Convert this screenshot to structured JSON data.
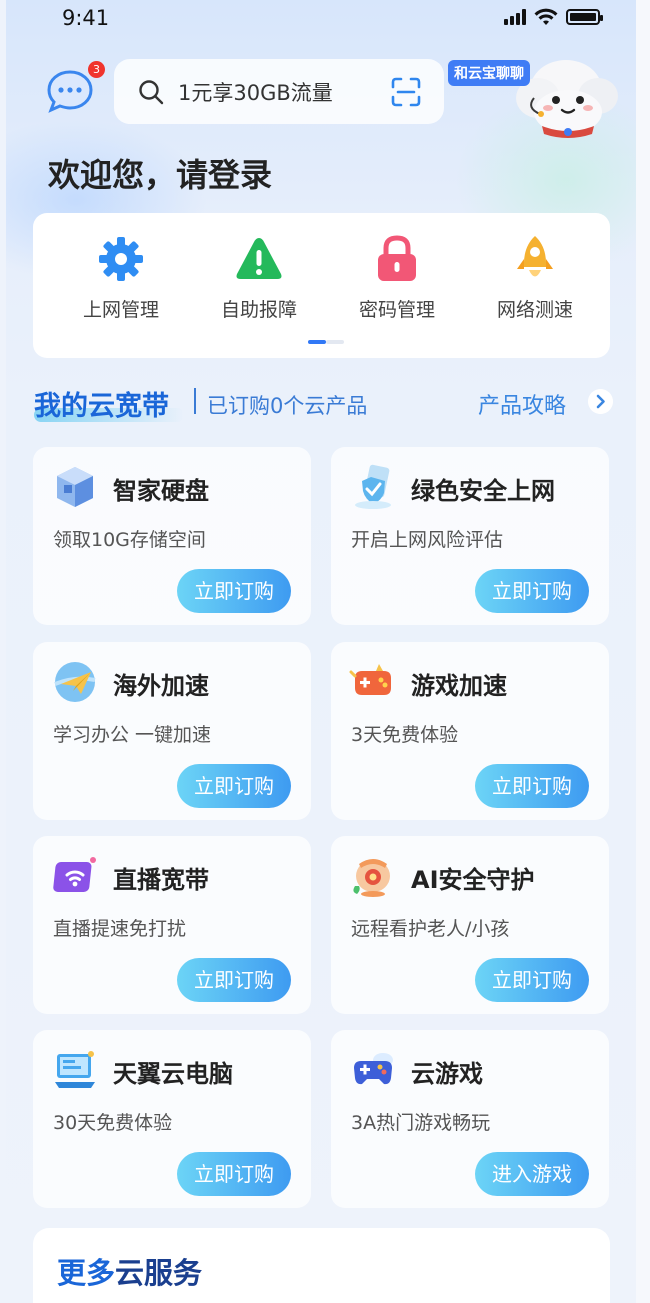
{
  "status_bar": {
    "time": "9:41"
  },
  "header": {
    "message_badge": "3",
    "search_placeholder": "1元享30GB流量",
    "assistant_label": "和云宝聊聊"
  },
  "greeting": "欢迎您，请登录",
  "quick_menu": {
    "items": [
      {
        "label": "上网管理",
        "icon": "gear-icon",
        "color": "#2f8df3"
      },
      {
        "label": "自助报障",
        "icon": "warning-icon",
        "color": "#24b95b"
      },
      {
        "label": "密码管理",
        "icon": "lock-icon",
        "color": "#f25776"
      },
      {
        "label": "网络测速",
        "icon": "rocket-icon",
        "color": "#f5b130"
      }
    ],
    "page_indicator": {
      "current": 1,
      "total": 2
    }
  },
  "section": {
    "title": "我的云宽带",
    "subtitle": "已订购0个云产品",
    "link": "产品攻略"
  },
  "products": [
    {
      "title": "智家硬盘",
      "desc": "领取10G存储空间",
      "button": "立即订购",
      "icon": "storage-box-icon"
    },
    {
      "title": "绿色安全上网",
      "desc": "开启上网风险评估",
      "button": "立即订购",
      "icon": "shield-icon"
    },
    {
      "title": "海外加速",
      "desc": "学习办公 一键加速",
      "button": "立即订购",
      "icon": "paper-plane-icon"
    },
    {
      "title": "游戏加速",
      "desc": "3天免费体验",
      "button": "立即订购",
      "icon": "gamepad-icon"
    },
    {
      "title": "直播宽带",
      "desc": "直播提速免打扰",
      "button": "立即订购",
      "icon": "wifi-icon"
    },
    {
      "title": "AI安全守护",
      "desc": "远程看护老人/小孩",
      "button": "立即订购",
      "icon": "camera-icon"
    },
    {
      "title": "天翼云电脑",
      "desc": "30天免费体验",
      "button": "立即订购",
      "icon": "computer-icon"
    },
    {
      "title": "云游戏",
      "desc": "3A热门游戏畅玩",
      "button": "进入游戏",
      "icon": "controller-icon"
    }
  ],
  "more_services": {
    "title_accent": "更多",
    "title_rest": "云服务"
  }
}
